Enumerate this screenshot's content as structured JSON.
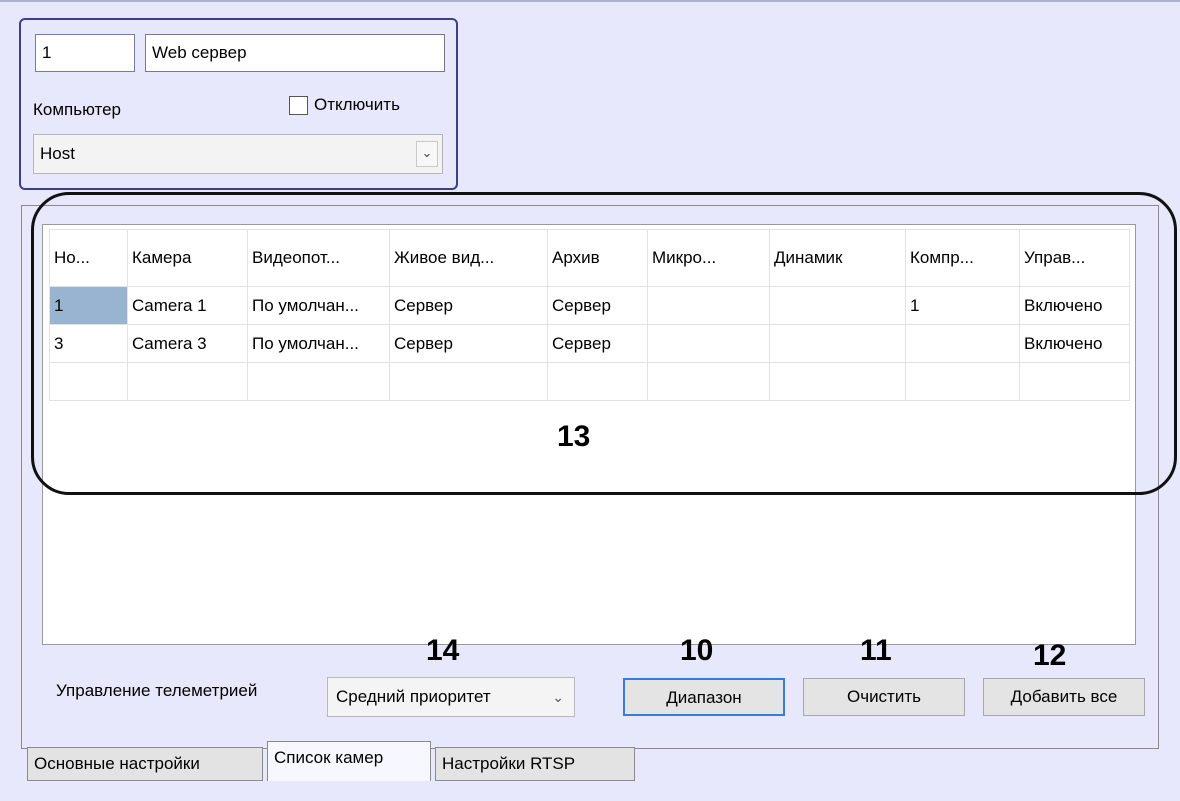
{
  "object": {
    "id_value": "1",
    "name_value": "Web сервер",
    "computer_label": "Компьютер",
    "disable_label": "Отключить",
    "computer_select": "Host"
  },
  "table": {
    "headers": [
      "Но...",
      "Камера",
      "Видеопот...",
      "Живое вид...",
      "Архив",
      "Микро...",
      "Динамик",
      "Компр...",
      "Управ..."
    ],
    "rows": [
      [
        "1",
        "Camera 1",
        "По умолчан...",
        "Сервер",
        "Сервер",
        "",
        "",
        "1",
        "Включено"
      ],
      [
        "3",
        "Camera 3",
        "По умолчан...",
        "Сервер",
        "Сервер",
        "",
        "",
        "",
        "Включено"
      ],
      [
        "",
        "",
        "",
        "",
        "",
        "",
        "",
        "",
        ""
      ]
    ]
  },
  "controls": {
    "telemetry_label": "Управление телеметрией",
    "telemetry_value": "Средний приоритет",
    "range_button": "Диапазон",
    "clear_button": "Очистить",
    "add_all_button": "Добавить все"
  },
  "tabs": [
    "Основные настройки",
    "Список камер",
    "Настройки RTSP"
  ],
  "callouts": {
    "c13": "13",
    "c14": "14",
    "c10": "10",
    "c11": "11",
    "c12": "12"
  }
}
